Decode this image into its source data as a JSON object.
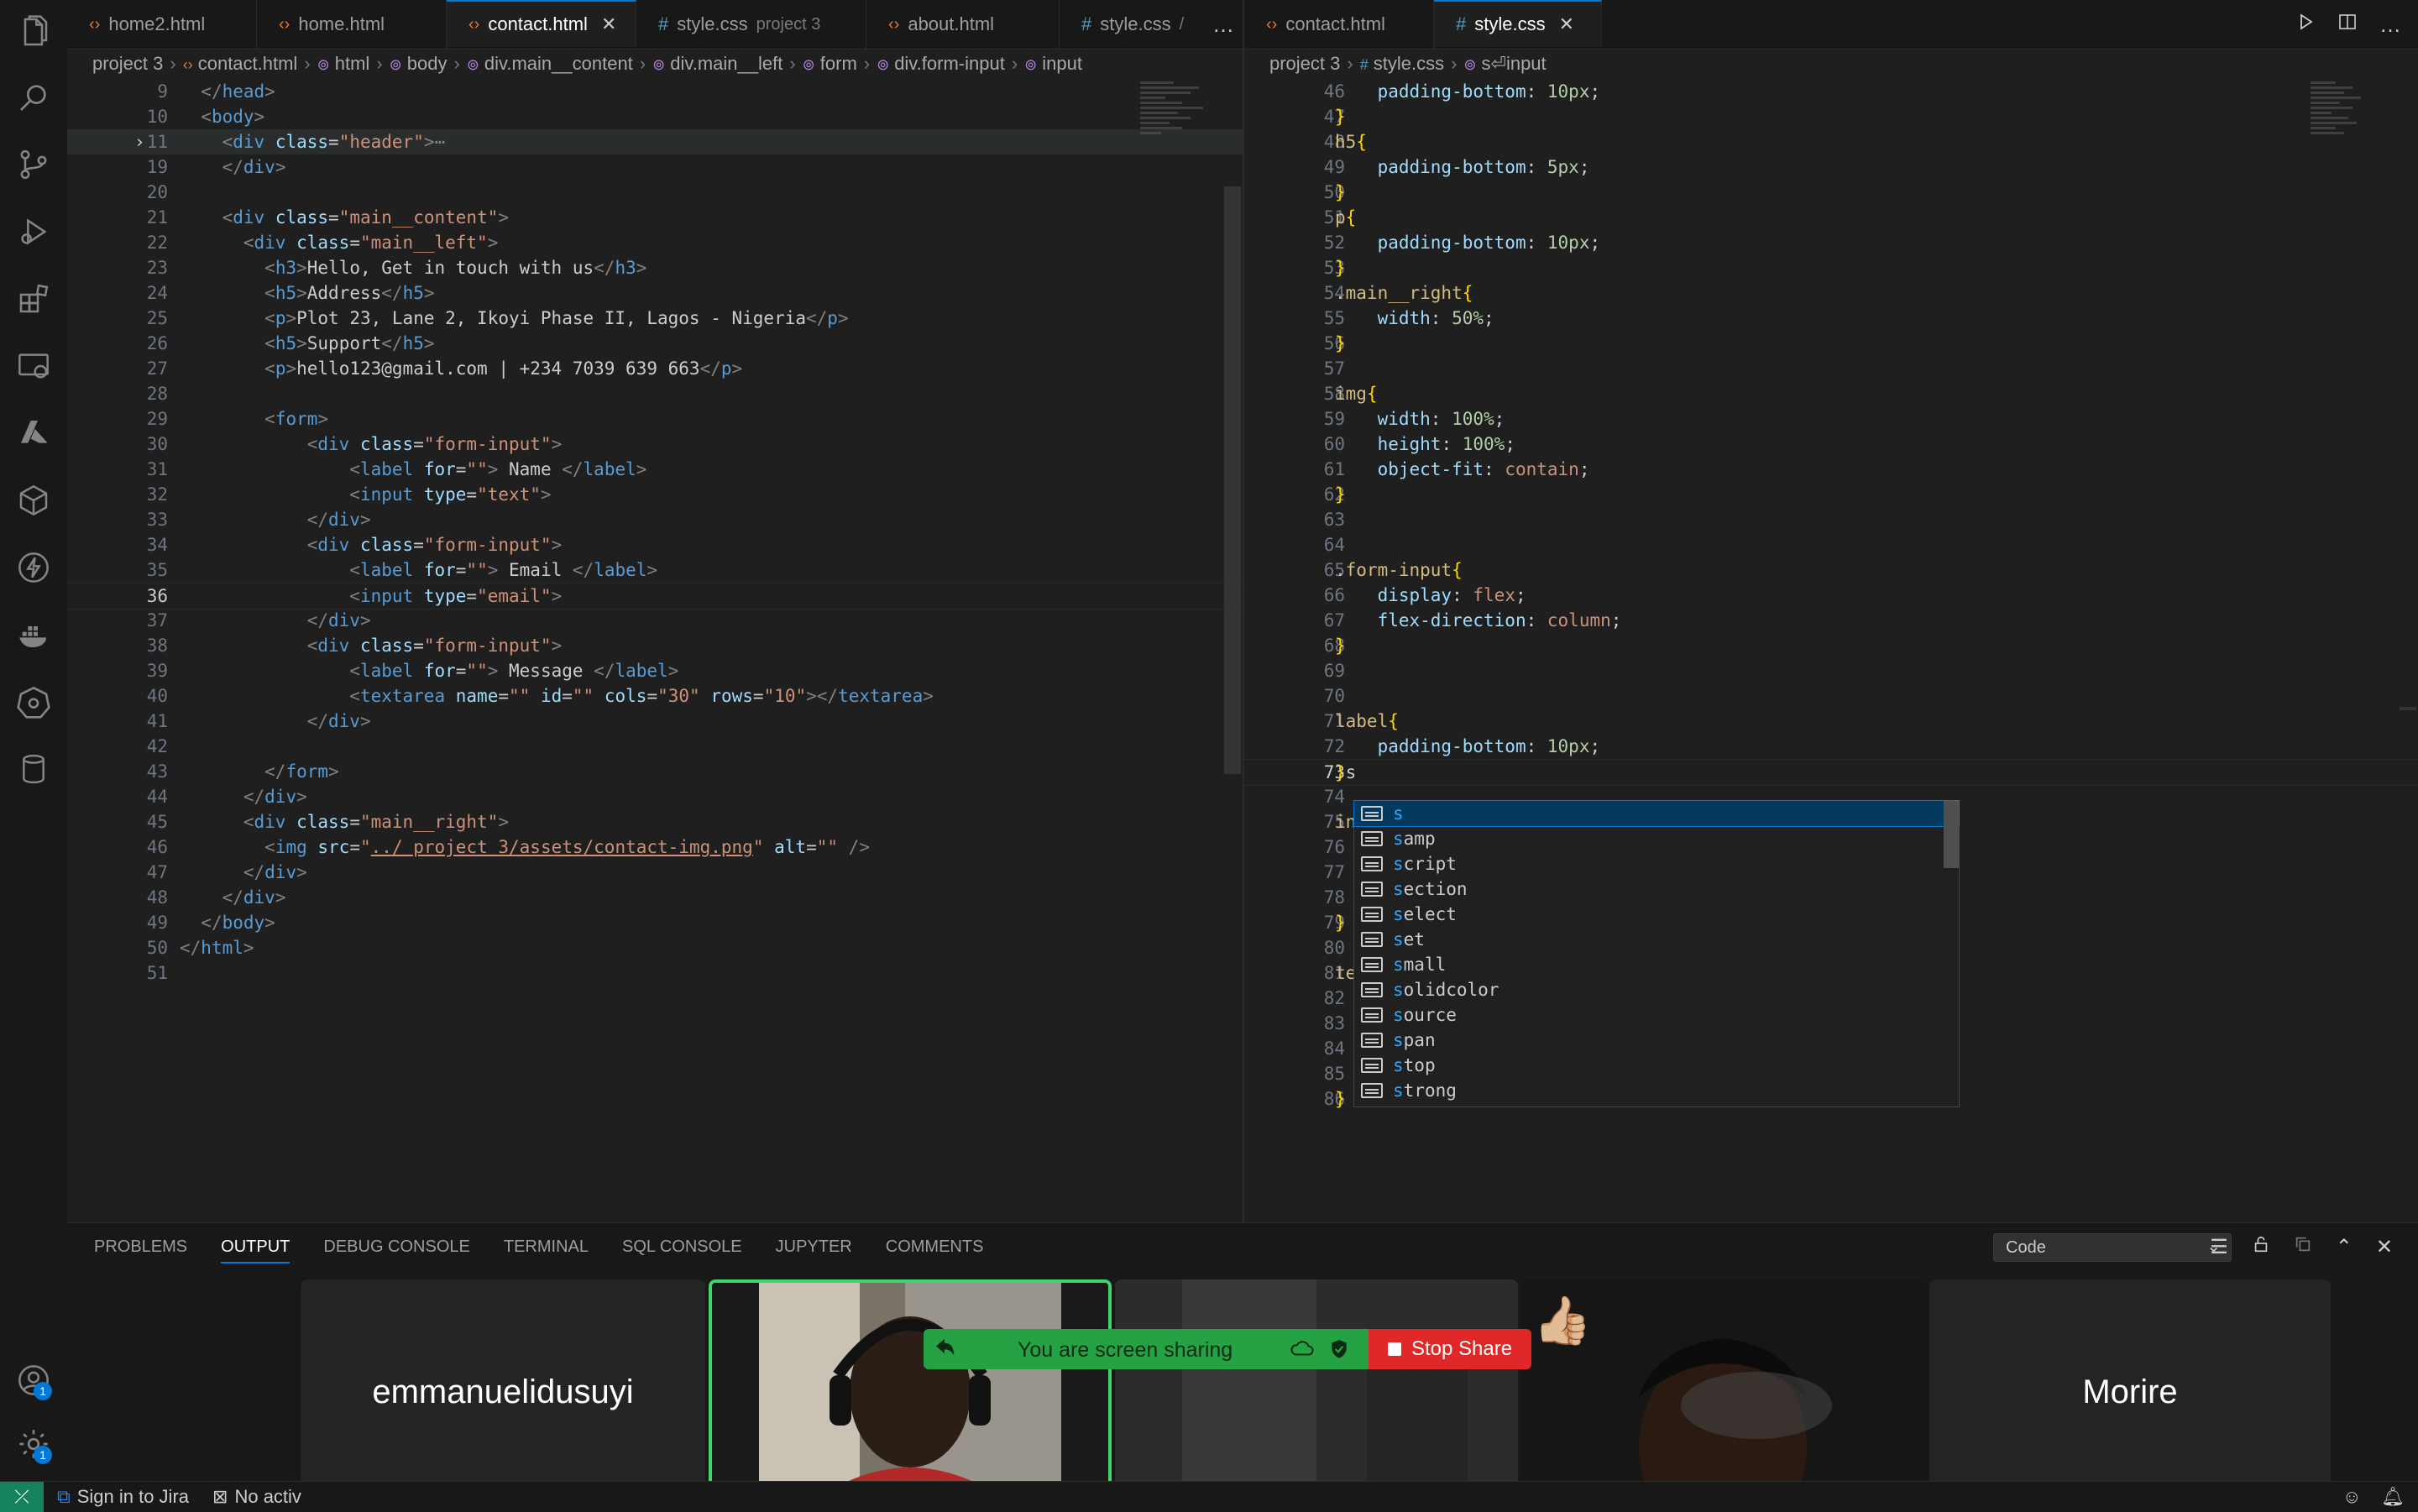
{
  "left_tabs": [
    {
      "label": "home2.html",
      "type": "html",
      "desc": "",
      "active": false
    },
    {
      "label": "home.html",
      "type": "html",
      "desc": "",
      "active": false
    },
    {
      "label": "contact.html",
      "type": "html",
      "desc": "",
      "active": true
    },
    {
      "label": "style.css",
      "type": "css",
      "desc": "project 3",
      "active": false
    },
    {
      "label": "about.html",
      "type": "html",
      "desc": "",
      "active": false
    },
    {
      "label": "style.css",
      "type": "css",
      "desc": "/",
      "active": false
    }
  ],
  "right_tabs": [
    {
      "label": "contact.html",
      "type": "html",
      "active": false
    },
    {
      "label": "style.css",
      "type": "css",
      "active": true
    }
  ],
  "more_icon": "…",
  "close_icon": "✕",
  "left_breadcrumb": [
    "project 3",
    "contact.html",
    "html",
    "body",
    "div.main__content",
    "div.main__left",
    "form",
    "div.form-input",
    "input"
  ],
  "right_breadcrumb": [
    "project 3",
    "style.css",
    "s⏎input"
  ],
  "left_code": [
    {
      "n": "9",
      "html": "  <span class='t-gray'>&lt;/</span><span class='t-tag'>head</span><span class='t-gray'>&gt;</span>"
    },
    {
      "n": "10",
      "html": "  <span class='t-gray'>&lt;</span><span class='t-tag'>body</span><span class='t-gray'>&gt;</span>"
    },
    {
      "n": "11",
      "html": "    <span class='t-gray'>&lt;</span><span class='t-tag'>div</span> <span class='t-attr'>class</span>=<span class='t-str'>\"header\"</span><span class='t-gray'>&gt;</span><span class='t-gray'>⋯</span>",
      "hl": true,
      "fold": true
    },
    {
      "n": "19",
      "html": "    <span class='t-gray'>&lt;/</span><span class='t-tag'>div</span><span class='t-gray'>&gt;</span>"
    },
    {
      "n": "20",
      "html": ""
    },
    {
      "n": "21",
      "html": "    <span class='t-gray'>&lt;</span><span class='t-tag'>div</span> <span class='t-attr'>class</span>=<span class='t-str'>\"main__content\"</span><span class='t-gray'>&gt;</span>"
    },
    {
      "n": "22",
      "html": "      <span class='t-gray'>&lt;</span><span class='t-tag'>div</span> <span class='t-attr'>class</span>=<span class='t-str'>\"main__left\"</span><span class='t-gray'>&gt;</span>"
    },
    {
      "n": "23",
      "html": "        <span class='t-gray'>&lt;</span><span class='t-tag'>h3</span><span class='t-gray'>&gt;</span>Hello, Get in touch with us<span class='t-gray'>&lt;/</span><span class='t-tag'>h3</span><span class='t-gray'>&gt;</span>"
    },
    {
      "n": "24",
      "html": "        <span class='t-gray'>&lt;</span><span class='t-tag'>h5</span><span class='t-gray'>&gt;</span>Address<span class='t-gray'>&lt;/</span><span class='t-tag'>h5</span><span class='t-gray'>&gt;</span>"
    },
    {
      "n": "25",
      "html": "        <span class='t-gray'>&lt;</span><span class='t-tag'>p</span><span class='t-gray'>&gt;</span>Plot 23, Lane 2, Ikoyi Phase II, Lagos - Nigeria<span class='t-gray'>&lt;/</span><span class='t-tag'>p</span><span class='t-gray'>&gt;</span>"
    },
    {
      "n": "26",
      "html": "        <span class='t-gray'>&lt;</span><span class='t-tag'>h5</span><span class='t-gray'>&gt;</span>Support<span class='t-gray'>&lt;/</span><span class='t-tag'>h5</span><span class='t-gray'>&gt;</span>"
    },
    {
      "n": "27",
      "html": "        <span class='t-gray'>&lt;</span><span class='t-tag'>p</span><span class='t-gray'>&gt;</span>hello123@gmail.com | +234 7039 639 663<span class='t-gray'>&lt;/</span><span class='t-tag'>p</span><span class='t-gray'>&gt;</span>"
    },
    {
      "n": "28",
      "html": ""
    },
    {
      "n": "29",
      "html": "        <span class='t-gray'>&lt;</span><span class='t-tag'>form</span><span class='t-gray'>&gt;</span>"
    },
    {
      "n": "30",
      "html": "            <span class='t-gray'>&lt;</span><span class='t-tag'>div</span> <span class='t-attr'>class</span>=<span class='t-str'>\"form-input\"</span><span class='t-gray'>&gt;</span>"
    },
    {
      "n": "31",
      "html": "                <span class='t-gray'>&lt;</span><span class='t-tag'>label</span> <span class='t-attr'>for</span>=<span class='t-str'>\"\"</span><span class='t-gray'>&gt;</span> Name <span class='t-gray'>&lt;/</span><span class='t-tag'>label</span><span class='t-gray'>&gt;</span>"
    },
    {
      "n": "32",
      "html": "                <span class='t-gray'>&lt;</span><span class='t-tag'>input</span> <span class='t-attr'>type</span>=<span class='t-str'>\"text\"</span><span class='t-gray'>&gt;</span>"
    },
    {
      "n": "33",
      "html": "            <span class='t-gray'>&lt;/</span><span class='t-tag'>div</span><span class='t-gray'>&gt;</span>"
    },
    {
      "n": "34",
      "html": "            <span class='t-gray'>&lt;</span><span class='t-tag'>div</span> <span class='t-attr'>class</span>=<span class='t-str'>\"form-input\"</span><span class='t-gray'>&gt;</span>"
    },
    {
      "n": "35",
      "html": "                <span class='t-gray'>&lt;</span><span class='t-tag'>label</span> <span class='t-attr'>for</span>=<span class='t-str'>\"\"</span><span class='t-gray'>&gt;</span> Email <span class='t-gray'>&lt;/</span><span class='t-tag'>label</span><span class='t-gray'>&gt;</span>"
    },
    {
      "n": "36",
      "html": "                <span class='t-gray'>&lt;</span><span class='t-tag'>input</span> <span class='t-attr'>type</span>=<span class='t-str'>\"email\"</span><span class='t-gray'>&gt;</span>",
      "cur": true
    },
    {
      "n": "37",
      "html": "            <span class='t-gray'>&lt;/</span><span class='t-tag'>div</span><span class='t-gray'>&gt;</span>"
    },
    {
      "n": "38",
      "html": "            <span class='t-gray'>&lt;</span><span class='t-tag'>div</span> <span class='t-attr'>class</span>=<span class='t-str'>\"form-input\"</span><span class='t-gray'>&gt;</span>"
    },
    {
      "n": "39",
      "html": "                <span class='t-gray'>&lt;</span><span class='t-tag'>label</span> <span class='t-attr'>for</span>=<span class='t-str'>\"\"</span><span class='t-gray'>&gt;</span> Message <span class='t-gray'>&lt;/</span><span class='t-tag'>label</span><span class='t-gray'>&gt;</span>"
    },
    {
      "n": "40",
      "html": "                <span class='t-gray'>&lt;</span><span class='t-tag'>textarea</span> <span class='t-attr'>name</span>=<span class='t-str'>\"\"</span> <span class='t-attr'>id</span>=<span class='t-str'>\"\"</span> <span class='t-attr'>cols</span>=<span class='t-str'>\"30\"</span> <span class='t-attr'>rows</span>=<span class='t-str'>\"10\"</span><span class='t-gray'>&gt;&lt;/</span><span class='t-tag'>textarea</span><span class='t-gray'>&gt;</span>"
    },
    {
      "n": "41",
      "html": "            <span class='t-gray'>&lt;/</span><span class='t-tag'>div</span><span class='t-gray'>&gt;</span>"
    },
    {
      "n": "42",
      "html": ""
    },
    {
      "n": "43",
      "html": "        <span class='t-gray'>&lt;/</span><span class='t-tag'>form</span><span class='t-gray'>&gt;</span>"
    },
    {
      "n": "44",
      "html": "      <span class='t-gray'>&lt;/</span><span class='t-tag'>div</span><span class='t-gray'>&gt;</span>"
    },
    {
      "n": "45",
      "html": "      <span class='t-gray'>&lt;</span><span class='t-tag'>div</span> <span class='t-attr'>class</span>=<span class='t-str'>\"main__right\"</span><span class='t-gray'>&gt;</span>"
    },
    {
      "n": "46",
      "html": "        <span class='t-gray'>&lt;</span><span class='t-tag'>img</span> <span class='t-attr'>src</span>=<span class='t-str'>\"</span><span class='t-link'>../ project 3/assets/contact-img.png</span><span class='t-str'>\"</span> <span class='t-attr'>alt</span>=<span class='t-str'>\"\"</span> <span class='t-gray'>/&gt;</span>"
    },
    {
      "n": "47",
      "html": "      <span class='t-gray'>&lt;/</span><span class='t-tag'>div</span><span class='t-gray'>&gt;</span>"
    },
    {
      "n": "48",
      "html": "    <span class='t-gray'>&lt;/</span><span class='t-tag'>div</span><span class='t-gray'>&gt;</span>"
    },
    {
      "n": "49",
      "html": "  <span class='t-gray'>&lt;/</span><span class='t-tag'>body</span><span class='t-gray'>&gt;</span>"
    },
    {
      "n": "50",
      "html": "<span class='t-gray'>&lt;/</span><span class='t-tag'>html</span><span class='t-gray'>&gt;</span>"
    },
    {
      "n": "51",
      "html": ""
    }
  ],
  "right_code": [
    {
      "n": "46",
      "html": "    <span class='t-prop'>padding-bottom</span>: <span class='t-num'>10px</span>;"
    },
    {
      "n": "47",
      "html": "<span class='t-brace'>}</span>"
    },
    {
      "n": "48",
      "html": "<span class='t-sel'>h5</span><span class='t-brace'>{</span>"
    },
    {
      "n": "49",
      "html": "    <span class='t-prop'>padding-bottom</span>: <span class='t-num'>5px</span>;"
    },
    {
      "n": "50",
      "html": "<span class='t-brace'>}</span>"
    },
    {
      "n": "51",
      "html": "<span class='t-sel'>p</span><span class='t-brace'>{</span>"
    },
    {
      "n": "52",
      "html": "    <span class='t-prop'>padding-bottom</span>: <span class='t-num'>10px</span>;"
    },
    {
      "n": "53",
      "html": "<span class='t-brace'>}</span>"
    },
    {
      "n": "54",
      "html": "<span class='t-sel'>.main__right</span><span class='t-brace'>{</span>"
    },
    {
      "n": "55",
      "html": "    <span class='t-prop'>width</span>: <span class='t-num'>50%</span>;"
    },
    {
      "n": "56",
      "html": "<span class='t-brace'>}</span>"
    },
    {
      "n": "57",
      "html": ""
    },
    {
      "n": "58",
      "html": "<span class='t-sel'>img</span><span class='t-brace'>{</span>"
    },
    {
      "n": "59",
      "html": "    <span class='t-prop'>width</span>: <span class='t-num'>100%</span>;"
    },
    {
      "n": "60",
      "html": "    <span class='t-prop'>height</span>: <span class='t-num'>100%</span>;"
    },
    {
      "n": "61",
      "html": "    <span class='t-prop'>object-fit</span>: <span class='t-val'>contain</span>;"
    },
    {
      "n": "62",
      "html": "<span class='t-brace'>}</span>"
    },
    {
      "n": "63",
      "html": ""
    },
    {
      "n": "64",
      "html": ""
    },
    {
      "n": "65",
      "html": "<span class='t-sel'>.form-input</span><span class='t-brace'>{</span>"
    },
    {
      "n": "66",
      "html": "    <span class='t-prop'>display</span>: <span class='t-val'>flex</span>;"
    },
    {
      "n": "67",
      "html": "    <span class='t-prop'>flex-direction</span>: <span class='t-val'>column</span>;"
    },
    {
      "n": "68",
      "html": "<span class='t-brace'>}</span>"
    },
    {
      "n": "69",
      "html": ""
    },
    {
      "n": "70",
      "html": ""
    },
    {
      "n": "71",
      "html": "<span class='t-sel'>label</span><span class='t-brace'>{</span>"
    },
    {
      "n": "72",
      "html": "    <span class='t-prop'>padding-bottom</span>: <span class='t-num'>10px</span>;"
    },
    {
      "n": "73",
      "html": "<span class='t-brace'>}</span>s",
      "cur": true
    },
    {
      "n": "74",
      "html": ""
    },
    {
      "n": "75",
      "html": "<span class='t-sel'>in</span>"
    },
    {
      "n": "76",
      "html": ""
    },
    {
      "n": "77",
      "html": ""
    },
    {
      "n": "78",
      "html": ""
    },
    {
      "n": "79",
      "html": "<span class='t-brace'>}</span>"
    },
    {
      "n": "80",
      "html": ""
    },
    {
      "n": "81",
      "html": "<span class='t-sel'>te</span>"
    },
    {
      "n": "82",
      "html": ""
    },
    {
      "n": "83",
      "html": ""
    },
    {
      "n": "84",
      "html": ""
    },
    {
      "n": "85",
      "html": ""
    },
    {
      "n": "86",
      "html": "<span class='t-brace'>}</span>"
    }
  ],
  "suggestions": [
    "s",
    "samp",
    "script",
    "section",
    "select",
    "set",
    "small",
    "solidcolor",
    "source",
    "span",
    "stop",
    "strong"
  ],
  "panel": {
    "tabs": [
      "PROBLEMS",
      "OUTPUT",
      "DEBUG CONSOLE",
      "TERMINAL",
      "SQL CONSOLE",
      "JUPYTER",
      "COMMENTS"
    ],
    "active_tab": "OUTPUT",
    "select_value": "Code"
  },
  "meeting": {
    "participant_left": "emmanuelidusuyi",
    "participant_right": "Morire",
    "sharing_text": "You are screen sharing",
    "stop_label": "Stop Share",
    "reaction": "👍🏼"
  },
  "status": {
    "jira": "Sign in to Jira",
    "activity": "No activ"
  },
  "activity_badges": {
    "accounts": "1",
    "manage": "1"
  },
  "colors": {
    "accent": "#0078d4",
    "remote": "#16825d",
    "share_green": "#25a244",
    "stop_red": "#e02828"
  }
}
